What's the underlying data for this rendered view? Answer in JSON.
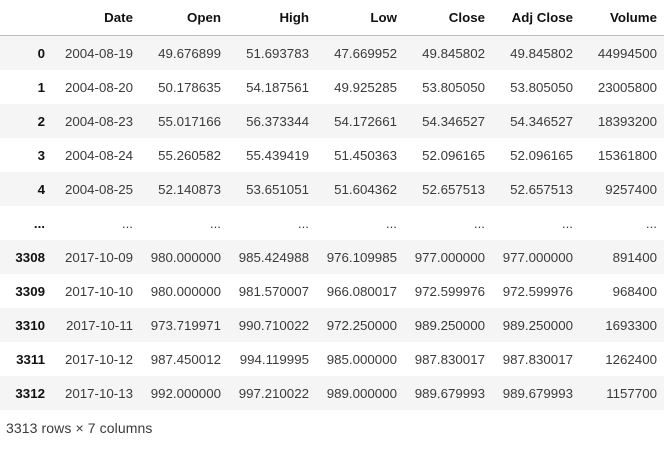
{
  "dataframe": {
    "columns": [
      "Date",
      "Open",
      "High",
      "Low",
      "Close",
      "Adj Close",
      "Volume"
    ],
    "rows": [
      {
        "index": "0",
        "values": [
          "2004-08-19",
          "49.676899",
          "51.693783",
          "47.669952",
          "49.845802",
          "49.845802",
          "44994500"
        ]
      },
      {
        "index": "1",
        "values": [
          "2004-08-20",
          "50.178635",
          "54.187561",
          "49.925285",
          "53.805050",
          "53.805050",
          "23005800"
        ]
      },
      {
        "index": "2",
        "values": [
          "2004-08-23",
          "55.017166",
          "56.373344",
          "54.172661",
          "54.346527",
          "54.346527",
          "18393200"
        ]
      },
      {
        "index": "3",
        "values": [
          "2004-08-24",
          "55.260582",
          "55.439419",
          "51.450363",
          "52.096165",
          "52.096165",
          "15361800"
        ]
      },
      {
        "index": "4",
        "values": [
          "2004-08-25",
          "52.140873",
          "53.651051",
          "51.604362",
          "52.657513",
          "52.657513",
          "9257400"
        ]
      },
      {
        "index": "...",
        "values": [
          "...",
          "...",
          "...",
          "...",
          "...",
          "...",
          "..."
        ]
      },
      {
        "index": "3308",
        "values": [
          "2017-10-09",
          "980.000000",
          "985.424988",
          "976.109985",
          "977.000000",
          "977.000000",
          "891400"
        ]
      },
      {
        "index": "3309",
        "values": [
          "2017-10-10",
          "980.000000",
          "981.570007",
          "966.080017",
          "972.599976",
          "972.599976",
          "968400"
        ]
      },
      {
        "index": "3310",
        "values": [
          "2017-10-11",
          "973.719971",
          "990.710022",
          "972.250000",
          "989.250000",
          "989.250000",
          "1693300"
        ]
      },
      {
        "index": "3311",
        "values": [
          "2017-10-12",
          "987.450012",
          "994.119995",
          "985.000000",
          "987.830017",
          "987.830017",
          "1262400"
        ]
      },
      {
        "index": "3312",
        "values": [
          "2017-10-13",
          "992.000000",
          "997.210022",
          "989.000000",
          "989.679993",
          "989.679993",
          "1157700"
        ]
      }
    ],
    "shape_text": "3313 rows × 7 columns"
  },
  "colors": {
    "row_stripe": "#f5f5f5",
    "header_border": "#bdbdbd",
    "text": "#3b3b3b"
  }
}
